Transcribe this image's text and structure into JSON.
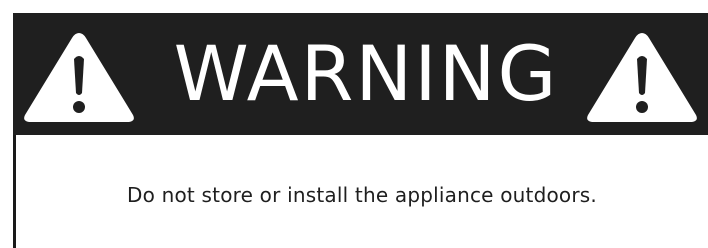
{
  "label": {
    "title": "WARNING",
    "message": "Do not store or install the appliance outdoors.",
    "header_color": "#1f1f1f",
    "icon": "warning-triangle-icon"
  }
}
